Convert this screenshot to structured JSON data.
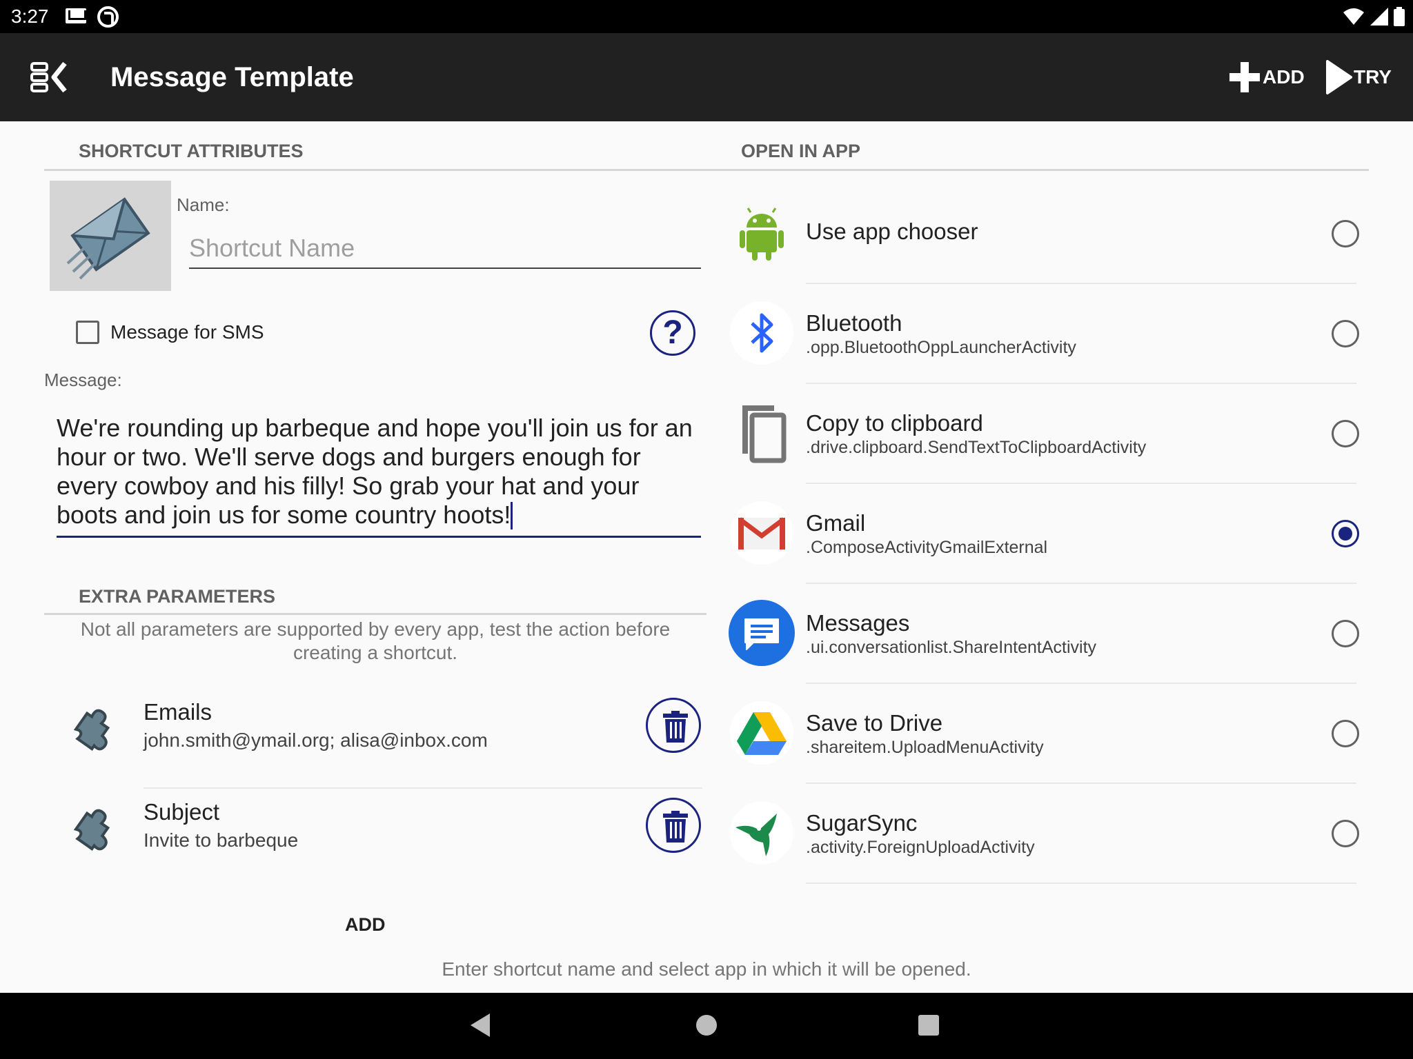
{
  "status_bar": {
    "time": "3:27"
  },
  "toolbar": {
    "title": "Message Template",
    "add_label": "ADD",
    "try_label": "TRY"
  },
  "left": {
    "section_title": "SHORTCUT ATTRIBUTES",
    "name_label": "Name:",
    "name_placeholder": "Shortcut Name",
    "name_value": "",
    "sms_checkbox_label": "Message for SMS",
    "sms_checked": false,
    "help_label": "?",
    "message_label": "Message:",
    "message_value": "We're rounding up barbeque and hope you'll join us for an hour or two. We'll serve dogs and burgers enough for every cowboy and his filly! So grab your hat and your boots and join us for some country hoots!",
    "extra_section_title": "EXTRA PARAMETERS",
    "extra_note": "Not all parameters are supported by every app, test the action before creating a shortcut.",
    "params": [
      {
        "name": "Emails",
        "value": "john.smith@ymail.org; alisa@inbox.com",
        "icon": "puzzle-icon"
      },
      {
        "name": "Subject",
        "value": "Invite to barbeque",
        "icon": "puzzle-icon"
      }
    ],
    "add_param_label": "ADD"
  },
  "right": {
    "section_title": "OPEN IN APP",
    "apps": [
      {
        "name": "Use app chooser",
        "activity": "",
        "icon": "android-icon",
        "selected": false
      },
      {
        "name": "Bluetooth",
        "activity": ".opp.BluetoothOppLauncherActivity",
        "icon": "bluetooth-icon",
        "selected": false
      },
      {
        "name": "Copy to clipboard",
        "activity": ".drive.clipboard.SendTextToClipboardActivity",
        "icon": "clipboard-icon",
        "selected": false
      },
      {
        "name": "Gmail",
        "activity": ".ComposeActivityGmailExternal",
        "icon": "gmail-icon",
        "selected": true
      },
      {
        "name": "Messages",
        "activity": ".ui.conversationlist.ShareIntentActivity",
        "icon": "messages-icon",
        "selected": false
      },
      {
        "name": "Save to Drive",
        "activity": ".shareitem.UploadMenuActivity",
        "icon": "drive-icon",
        "selected": false
      },
      {
        "name": "SugarSync",
        "activity": ".activity.ForeignUploadActivity",
        "icon": "sugarsync-icon",
        "selected": false
      }
    ]
  },
  "hint": "Enter shortcut name and select app in which it will be opened.",
  "colors": {
    "toolbar_bg": "#212121",
    "accent": "#1a237e",
    "background": "#fafafa"
  }
}
